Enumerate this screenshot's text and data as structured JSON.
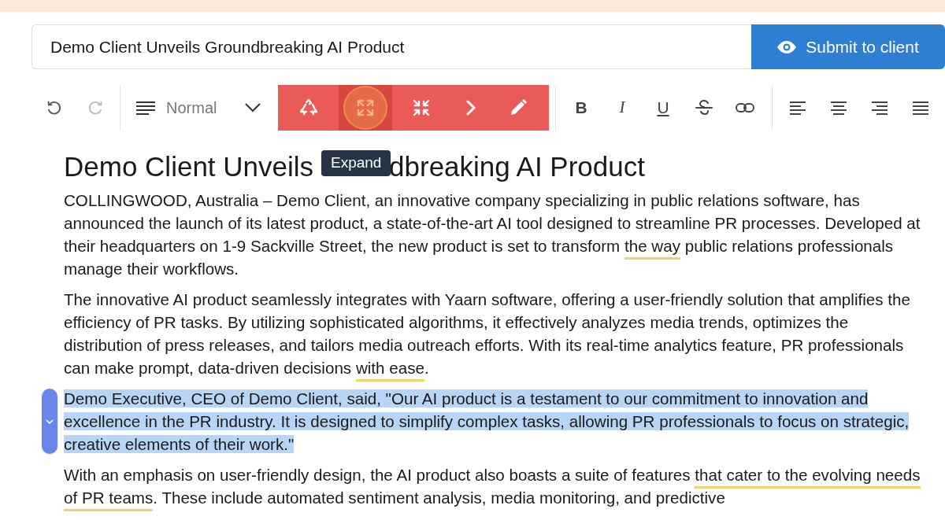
{
  "title_field": {
    "value": "Demo Client Unveils Groundbreaking AI Product"
  },
  "submit_button": {
    "label": "Submit to client"
  },
  "toolbar": {
    "format": "Normal",
    "ai_tools": [
      {
        "kind": "recycle",
        "selected": false
      },
      {
        "kind": "expand",
        "selected": true
      },
      {
        "kind": "compress",
        "selected": false
      },
      {
        "kind": "next",
        "selected": false
      },
      {
        "kind": "edit",
        "selected": false
      }
    ],
    "tooltip": "Expand",
    "text_styles": [
      {
        "kind": "bold",
        "label": "B"
      },
      {
        "kind": "italic",
        "label": "I"
      },
      {
        "kind": "underline",
        "label": "U"
      },
      {
        "kind": "strike"
      },
      {
        "kind": "link"
      }
    ]
  },
  "document": {
    "heading_parts": [
      "Demo Client Unveils",
      "dbreaking AI Product"
    ],
    "paragraphs": [
      {
        "selected": false,
        "segments": [
          {
            "text": "COLLINGWOOD, Australia – Demo Client, an innovative company specializing in public relations software, has announced the launch of its latest product, a state-of-the-art AI tool designed to streamline PR processes. Developed at their headquarters on 1-9 Sackville Street, the new product is set to transform ",
            "flagged": false
          },
          {
            "text": "the way",
            "flagged": true
          },
          {
            "text": " public relations professionals manage their workflows.",
            "flagged": false
          }
        ]
      },
      {
        "selected": false,
        "segments": [
          {
            "text": "The innovative AI product seamlessly integrates with Yaarn software, offering a user-friendly solution that amplifies the efficiency of PR tasks. By utilizing sophisticated algorithms, it effectively analyzes media trends, optimizes the distribution of press releases, and tailors media outreach efforts. With its real-time analytics feature, PR professionals can make prompt, data-driven decisions ",
            "flagged": false
          },
          {
            "text": "with ease",
            "flagged": true
          },
          {
            "text": ".",
            "flagged": false
          }
        ]
      },
      {
        "selected": true,
        "segments": [
          {
            "text": "Demo Executive, CEO of Demo Client, said, \"Our AI product is a testament to our commitment to innovation and excellence in the PR industry. It is designed to simplify complex tasks, allowing PR professionals to focus on strategic, creative elements of their work.\"",
            "flagged": false
          }
        ]
      },
      {
        "selected": false,
        "segments": [
          {
            "text": "With an emphasis on user-friendly design, the AI product also boasts a suite of features ",
            "flagged": false
          },
          {
            "text": "that cater to the evolving needs of PR teams",
            "flagged": true
          },
          {
            "text": ". These include automated sentiment analysis, media monitoring, and predictive",
            "flagged": false
          }
        ]
      }
    ]
  }
}
